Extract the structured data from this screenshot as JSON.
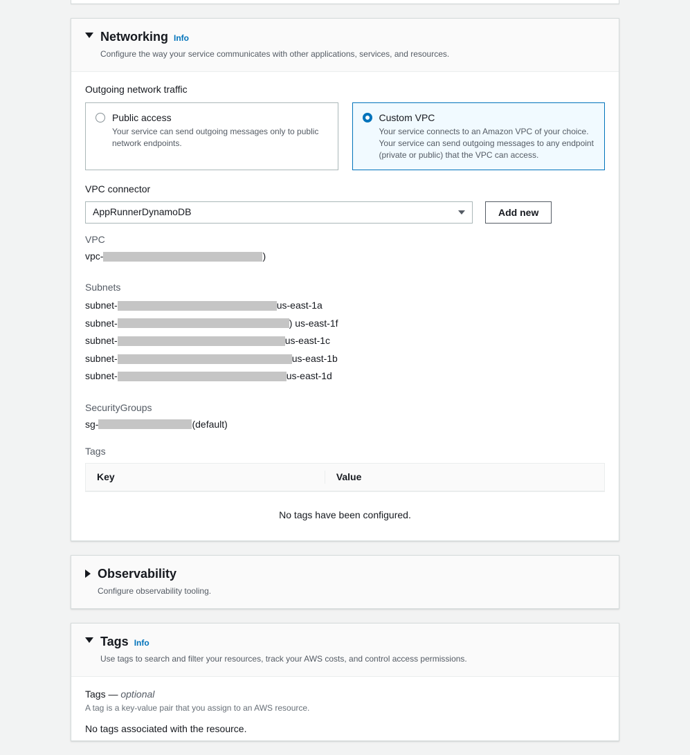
{
  "networking": {
    "title": "Networking",
    "info": "Info",
    "desc": "Configure the way your service communicates with other applications, services, and resources.",
    "outgoing_label": "Outgoing network traffic",
    "public": {
      "title": "Public access",
      "desc": "Your service can send outgoing messages only to public network endpoints."
    },
    "custom": {
      "title": "Custom VPC",
      "desc": "Your service connects to an Amazon VPC of your choice. Your service can send outgoing messages to any endpoint (private or public) that the VPC can access."
    },
    "vpc_connector_label": "VPC connector",
    "vpc_connector_value": "AppRunnerDynamoDB",
    "add_new": "Add new",
    "vpc_label": "VPC",
    "vpc_prefix": "vpc-",
    "vpc_suffix": ")",
    "subnets_label": "Subnets",
    "subnets": [
      {
        "prefix": "subnet-",
        "suffix": " us-east-1a",
        "redact_w": 230
      },
      {
        "prefix": "subnet-",
        "suffix": ") us-east-1f",
        "redact_w": 248
      },
      {
        "prefix": "subnet-",
        "suffix": " us-east-1c",
        "redact_w": 242
      },
      {
        "prefix": "subnet-",
        "suffix": " us-east-1b",
        "redact_w": 252
      },
      {
        "prefix": "subnet-",
        "suffix": " us-east-1d",
        "redact_w": 244
      }
    ],
    "sg_label": "SecurityGroups",
    "sg_prefix": "sg-",
    "sg_suffix": " (default)",
    "tags_label": "Tags",
    "tags_key": "Key",
    "tags_value": "Value",
    "tags_empty": "No tags have been configured."
  },
  "observability": {
    "title": "Observability",
    "desc": "Configure observability tooling."
  },
  "tags": {
    "title": "Tags",
    "info": "Info",
    "desc": "Use tags to search and filter your resources, track your AWS costs, and control access permissions.",
    "sub_label_a": "Tags — ",
    "sub_label_b": "optional",
    "hint": "A tag is a key-value pair that you assign to an AWS resource.",
    "none": "No tags associated with the resource."
  }
}
